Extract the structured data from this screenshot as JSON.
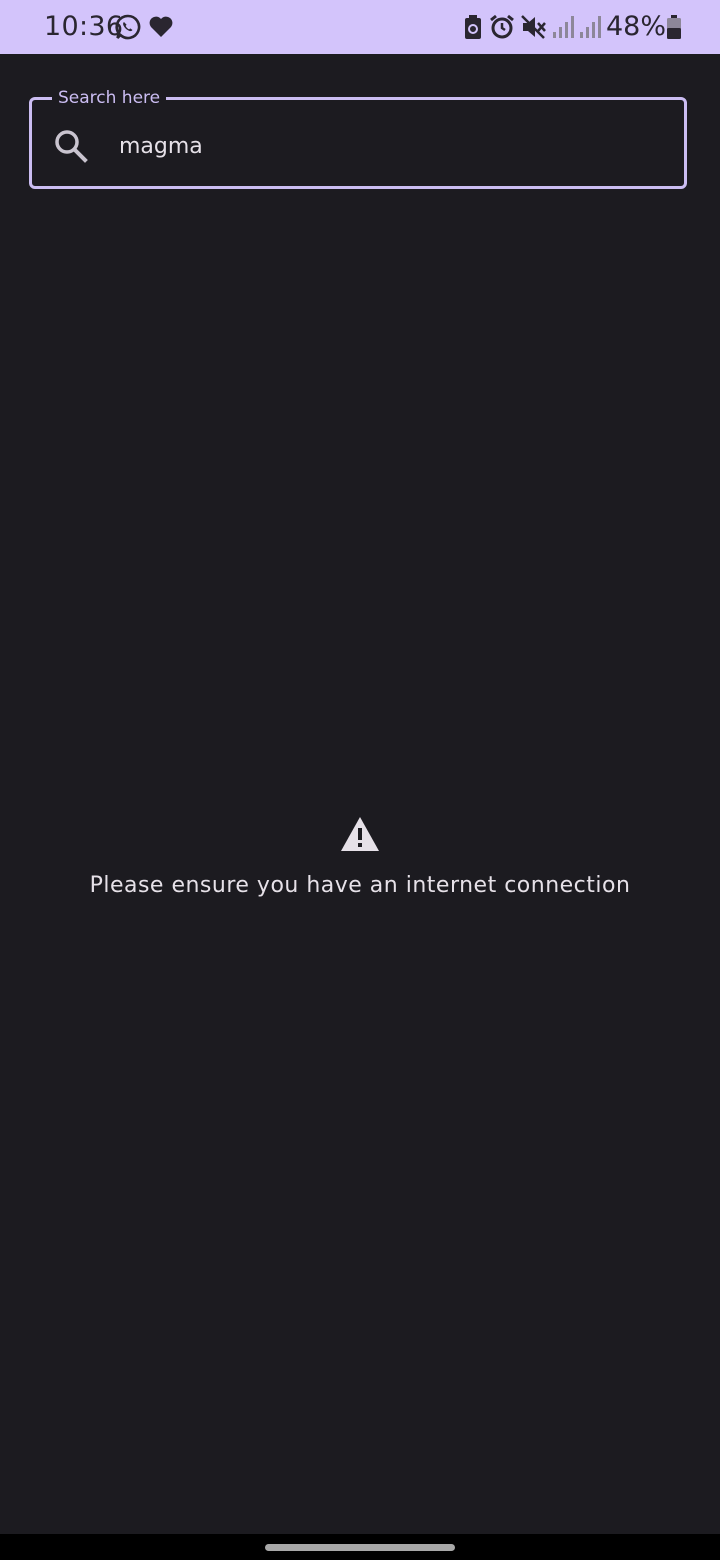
{
  "status_bar": {
    "time": "10:36",
    "battery_percent": "48%",
    "icons": [
      "whatsapp-icon",
      "heart-icon",
      "recycle-battery-icon",
      "alarm-icon",
      "mute-icon",
      "signal-icon",
      "signal-icon",
      "battery-icon"
    ],
    "background_color": "#d3c4fb"
  },
  "search": {
    "label": "Search here",
    "value": "magma",
    "accent_color": "#cbbdf2"
  },
  "empty_state": {
    "icon": "warning-icon",
    "message": "Please ensure you have an internet connection"
  },
  "theme": {
    "background": "#1c1b20",
    "text": "#e6e1e8"
  }
}
